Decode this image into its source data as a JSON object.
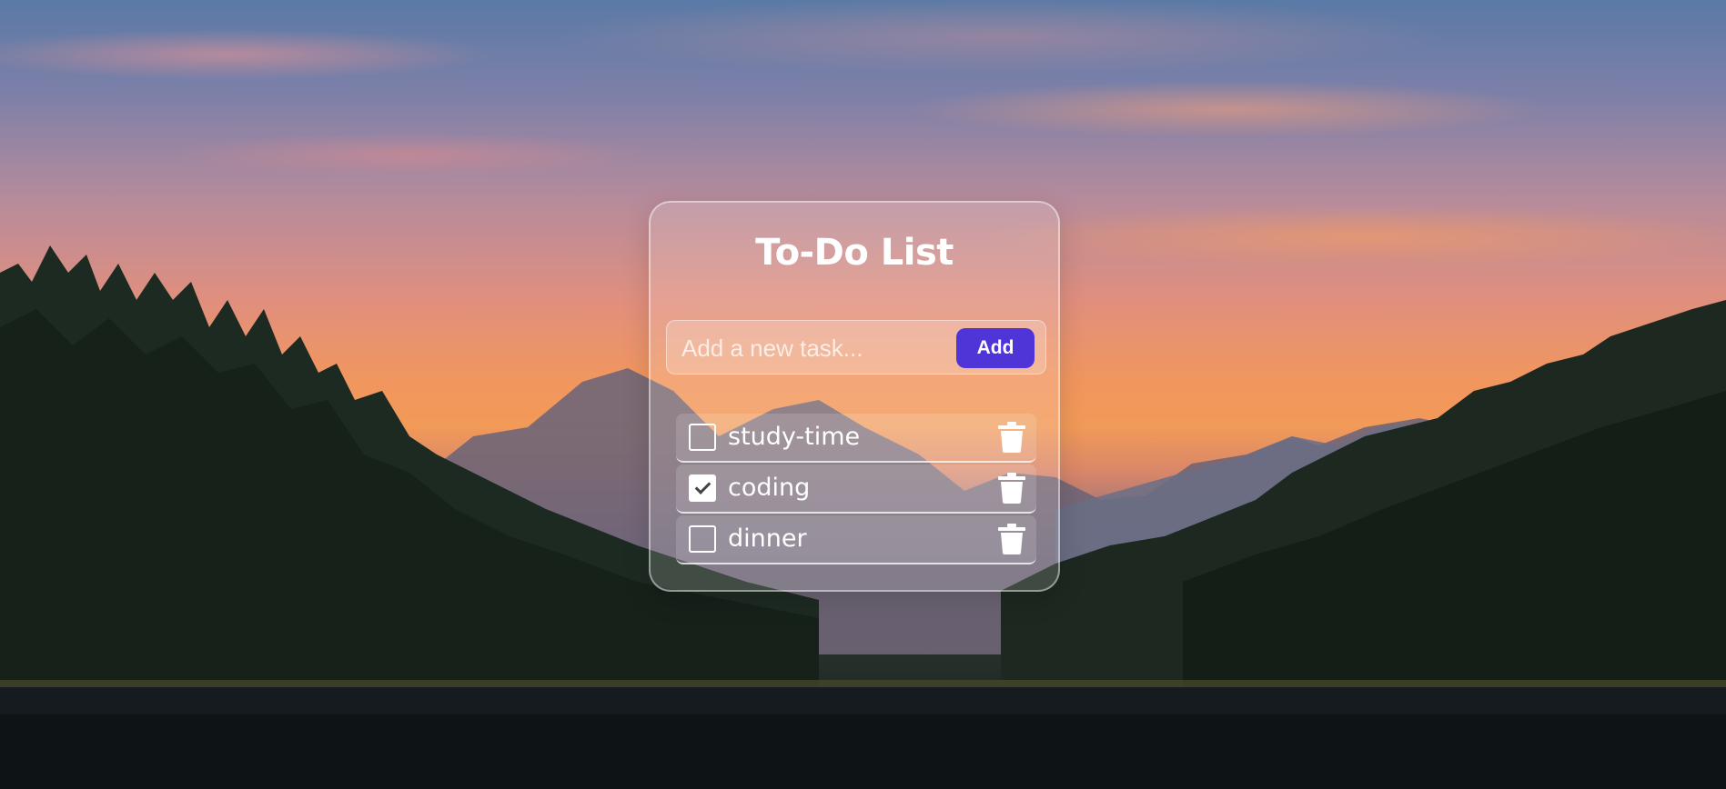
{
  "app": {
    "title": "To-Do List"
  },
  "input": {
    "placeholder": "Add a new task...",
    "value": "",
    "add_label": "Add"
  },
  "tasks": [
    {
      "label": "study-time",
      "done": false
    },
    {
      "label": "coding",
      "done": true
    },
    {
      "label": "dinner",
      "done": false
    }
  ],
  "colors": {
    "accent": "#4f35d8",
    "text": "#ffffff"
  },
  "icons": {
    "checkbox": "checkbox-icon",
    "delete": "trash-icon"
  }
}
